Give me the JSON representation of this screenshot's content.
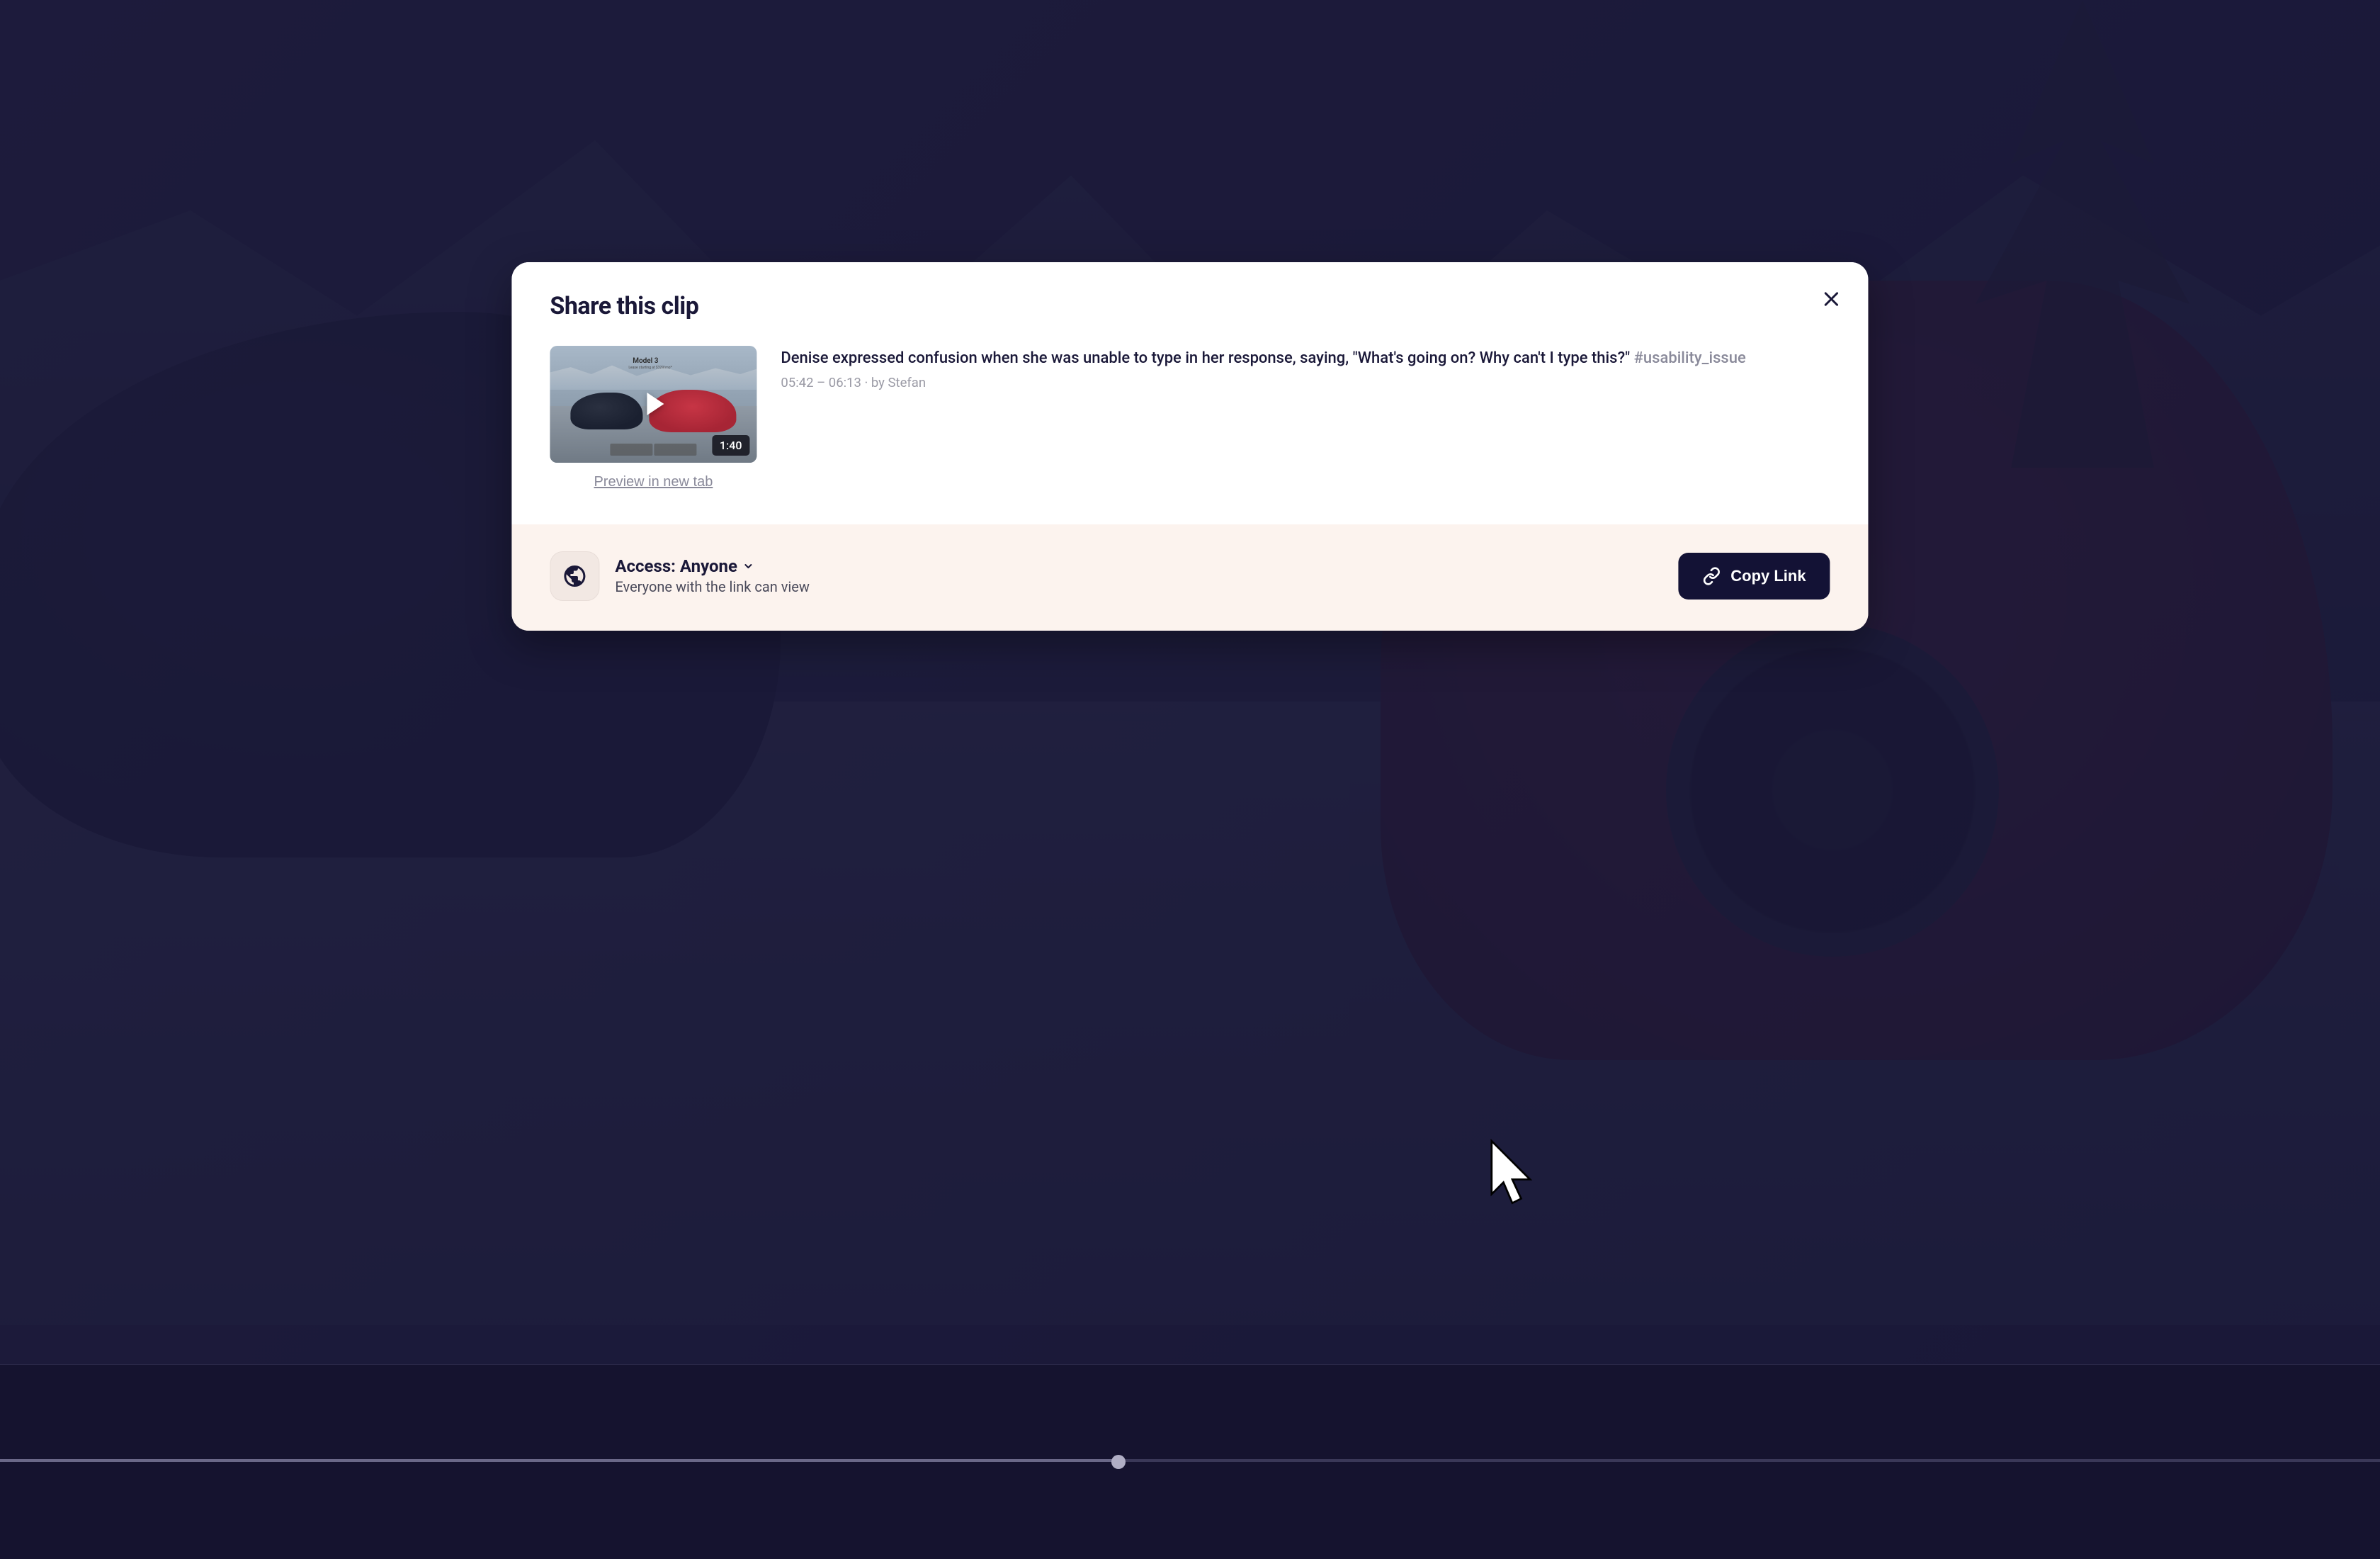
{
  "modal": {
    "title": "Share this clip",
    "close_aria": "Close"
  },
  "clip": {
    "duration": "1:40",
    "preview_link_label": "Preview in new tab",
    "thumbnail_title": "Model 3",
    "thumbnail_subtitle": "Lease starting at $329/mo*",
    "description": "Denise expressed confusion when she was unable to type in her response, saying, \"What's going on? Why can't I type this?\"",
    "hashtag": "#usability_issue",
    "time_range": "05:42 – 06:13",
    "author_prefix": "by",
    "author": "Stefan"
  },
  "access": {
    "label_prefix": "Access:",
    "level": "Anyone",
    "description": "Everyone with the link can view"
  },
  "actions": {
    "copy_link_label": "Copy Link"
  },
  "colors": {
    "modal_bg": "#ffffff",
    "modal_lower_bg": "#fcf3ee",
    "primary_button_bg": "#131235",
    "text_primary": "#1a1838",
    "text_muted": "#8a8a9a"
  }
}
